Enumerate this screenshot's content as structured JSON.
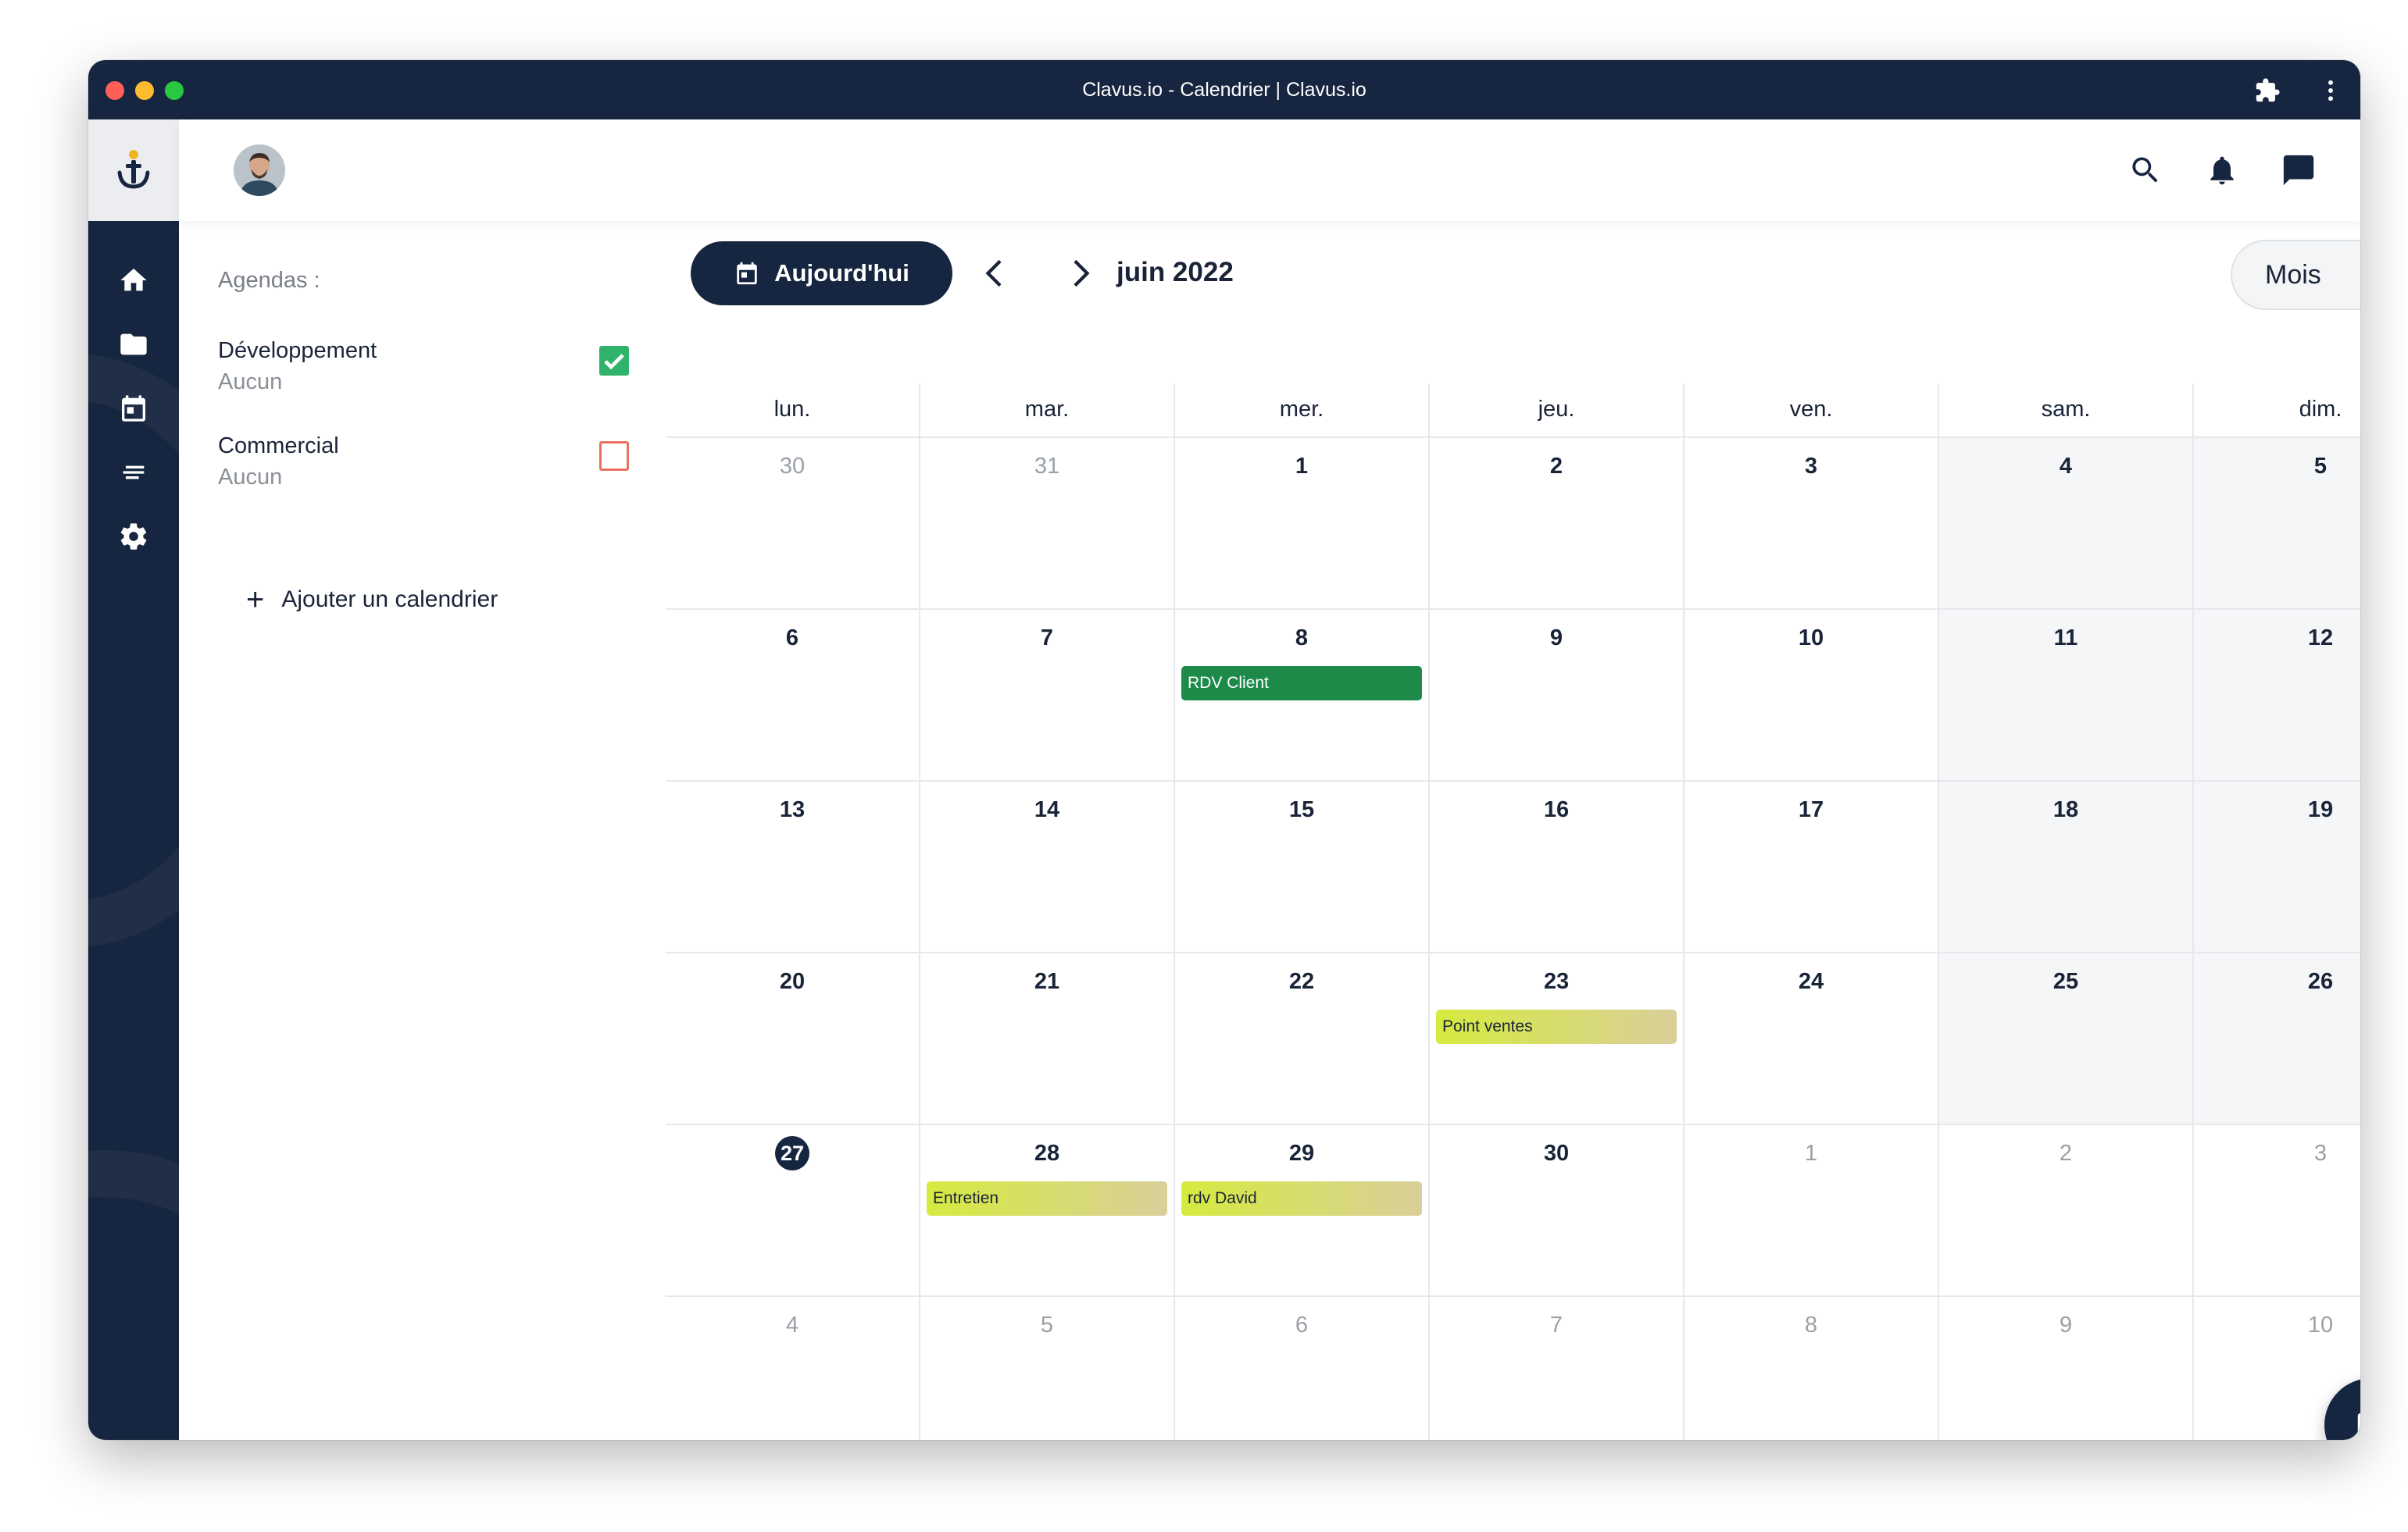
{
  "window": {
    "title": "Clavus.io - Calendrier | Clavus.io"
  },
  "sidebar": {
    "items": [
      {
        "icon": "home-icon"
      },
      {
        "icon": "folder-icon"
      },
      {
        "icon": "calendar-icon"
      },
      {
        "icon": "notes-icon"
      },
      {
        "icon": "gear-icon"
      }
    ]
  },
  "agendas": {
    "title": "Agendas :",
    "items": [
      {
        "name": "Développement",
        "subtitle": "Aucun",
        "checked": true,
        "color": "#2fb36b"
      },
      {
        "name": "Commercial",
        "subtitle": "Aucun",
        "checked": false,
        "color": "#e8715f"
      }
    ],
    "add_label": "Ajouter un calendrier"
  },
  "toolbar": {
    "today_label": "Aujourd'hui",
    "month_label": "juin 2022",
    "view_selected": "Mois"
  },
  "calendar": {
    "weekdays": [
      "lun.",
      "mar.",
      "mer.",
      "jeu.",
      "ven.",
      "sam.",
      "dim."
    ],
    "weeks": [
      [
        {
          "n": "30",
          "o": true
        },
        {
          "n": "31",
          "o": true
        },
        {
          "n": "1"
        },
        {
          "n": "2"
        },
        {
          "n": "3"
        },
        {
          "n": "4",
          "w": true
        },
        {
          "n": "5",
          "w": true
        }
      ],
      [
        {
          "n": "6"
        },
        {
          "n": "7"
        },
        {
          "n": "8",
          "ev": {
            "label": "RDV Client",
            "kind": "green"
          }
        },
        {
          "n": "9"
        },
        {
          "n": "10"
        },
        {
          "n": "11",
          "w": true
        },
        {
          "n": "12",
          "w": true
        }
      ],
      [
        {
          "n": "13"
        },
        {
          "n": "14"
        },
        {
          "n": "15"
        },
        {
          "n": "16"
        },
        {
          "n": "17"
        },
        {
          "n": "18",
          "w": true
        },
        {
          "n": "19",
          "w": true
        }
      ],
      [
        {
          "n": "20"
        },
        {
          "n": "21"
        },
        {
          "n": "22"
        },
        {
          "n": "23",
          "ev": {
            "label": "Point ventes",
            "kind": "lime"
          }
        },
        {
          "n": "24"
        },
        {
          "n": "25",
          "w": true
        },
        {
          "n": "26",
          "w": true
        }
      ],
      [
        {
          "n": "27",
          "t": true
        },
        {
          "n": "28",
          "ev": {
            "label": "Entretien",
            "kind": "lime"
          }
        },
        {
          "n": "29",
          "ev": {
            "label": "rdv David",
            "kind": "lime"
          }
        },
        {
          "n": "30"
        },
        {
          "n": "1",
          "o": true
        },
        {
          "n": "2",
          "o": true
        },
        {
          "n": "3",
          "o": true
        }
      ],
      [
        {
          "n": "4",
          "o": true
        },
        {
          "n": "5",
          "o": true
        },
        {
          "n": "6",
          "o": true
        },
        {
          "n": "7",
          "o": true
        },
        {
          "n": "8",
          "o": true
        },
        {
          "n": "9",
          "o": true
        },
        {
          "n": "10",
          "o": true
        }
      ]
    ]
  },
  "colors": {
    "navy": "#172640",
    "event_green": "#1d8a4a",
    "event_lime_start": "#d6ea3f",
    "event_lime_end": "#d9cf9a"
  }
}
